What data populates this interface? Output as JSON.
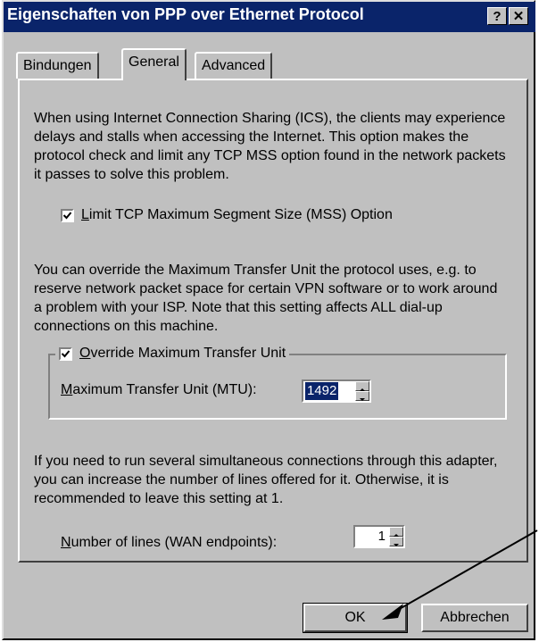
{
  "window": {
    "title": "Eigenschaften von PPP over Ethernet Protocol",
    "help_label": "?",
    "close_label": "✕"
  },
  "tabs": [
    {
      "label": "Bindungen",
      "active": false
    },
    {
      "label": "General",
      "active": true
    },
    {
      "label": "Advanced",
      "active": false
    }
  ],
  "general": {
    "ics_text": "When using Internet Connection Sharing (ICS), the clients may experience delays and stalls when accessing the Internet. This option makes the protocol check and limit any TCP MSS option found in the network packets it passes to solve this problem.",
    "mss_checkbox": {
      "label_rest": "imit TCP Maximum Segment Size (MSS) Option",
      "mnemonic": "L",
      "checked": true
    },
    "mtu_text": "You can override the Maximum Transfer Unit the protocol uses, e.g. to reserve network packet space for certain VPN software or to work around a problem with your ISP. Note that this setting affects ALL dial-up connections on this machine.",
    "override_checkbox": {
      "label_rest": "verride Maximum Transfer Unit",
      "mnemonic": "O",
      "checked": true
    },
    "mtu_field": {
      "label_rest": "aximum Transfer Unit (MTU):",
      "mnemonic": "M",
      "value": "1492"
    },
    "lines_text": "If you need to run several simultaneous connections through this adapter, you can increase the number of lines offered for it. Otherwise, it is recommended to leave this setting at 1.",
    "lines_field": {
      "label_rest": "umber of lines (WAN endpoints):",
      "mnemonic": "N",
      "value": "1"
    }
  },
  "buttons": {
    "ok": "OK",
    "cancel": "Abbrechen"
  },
  "colors": {
    "titlebar": "#0a246a",
    "face": "#c0c0c0",
    "selection": "#0a246a"
  }
}
